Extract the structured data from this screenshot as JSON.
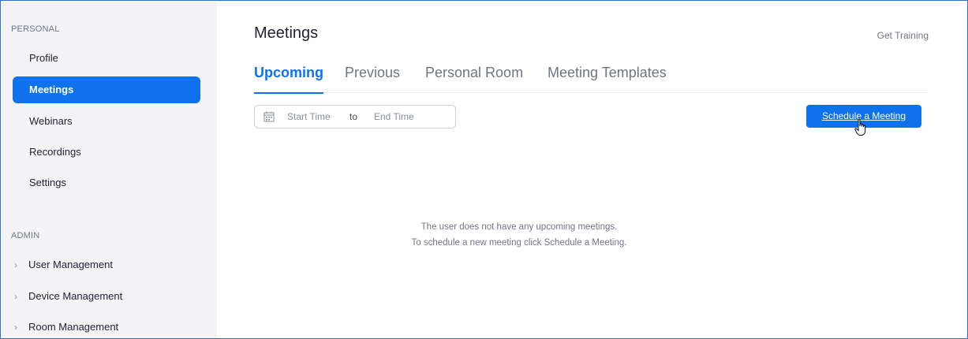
{
  "sidebar": {
    "personal_title": "PERSONAL",
    "personal_items": [
      {
        "label": "Profile"
      },
      {
        "label": "Meetings",
        "active": true
      },
      {
        "label": "Webinars"
      },
      {
        "label": "Recordings"
      },
      {
        "label": "Settings"
      }
    ],
    "admin_title": "ADMIN",
    "admin_items": [
      {
        "label": "User Management"
      },
      {
        "label": "Device Management"
      },
      {
        "label": "Room Management"
      }
    ]
  },
  "header": {
    "title": "Meetings",
    "get_training": "Get Training"
  },
  "tabs": [
    {
      "label": "Upcoming",
      "active": true
    },
    {
      "label": "Previous"
    },
    {
      "label": "Personal Room"
    },
    {
      "label": "Meeting Templates"
    }
  ],
  "filter": {
    "start_placeholder": "Start Time",
    "to_label": "to",
    "end_placeholder": "End Time"
  },
  "actions": {
    "schedule_label": "Schedule a Meeting"
  },
  "empty_state": {
    "line1": "The user does not have any upcoming meetings.",
    "line2": "To schedule a new meeting click Schedule a Meeting."
  },
  "colors": {
    "accent": "#0e72ed",
    "sidebar_bg": "#f4f4f6"
  }
}
